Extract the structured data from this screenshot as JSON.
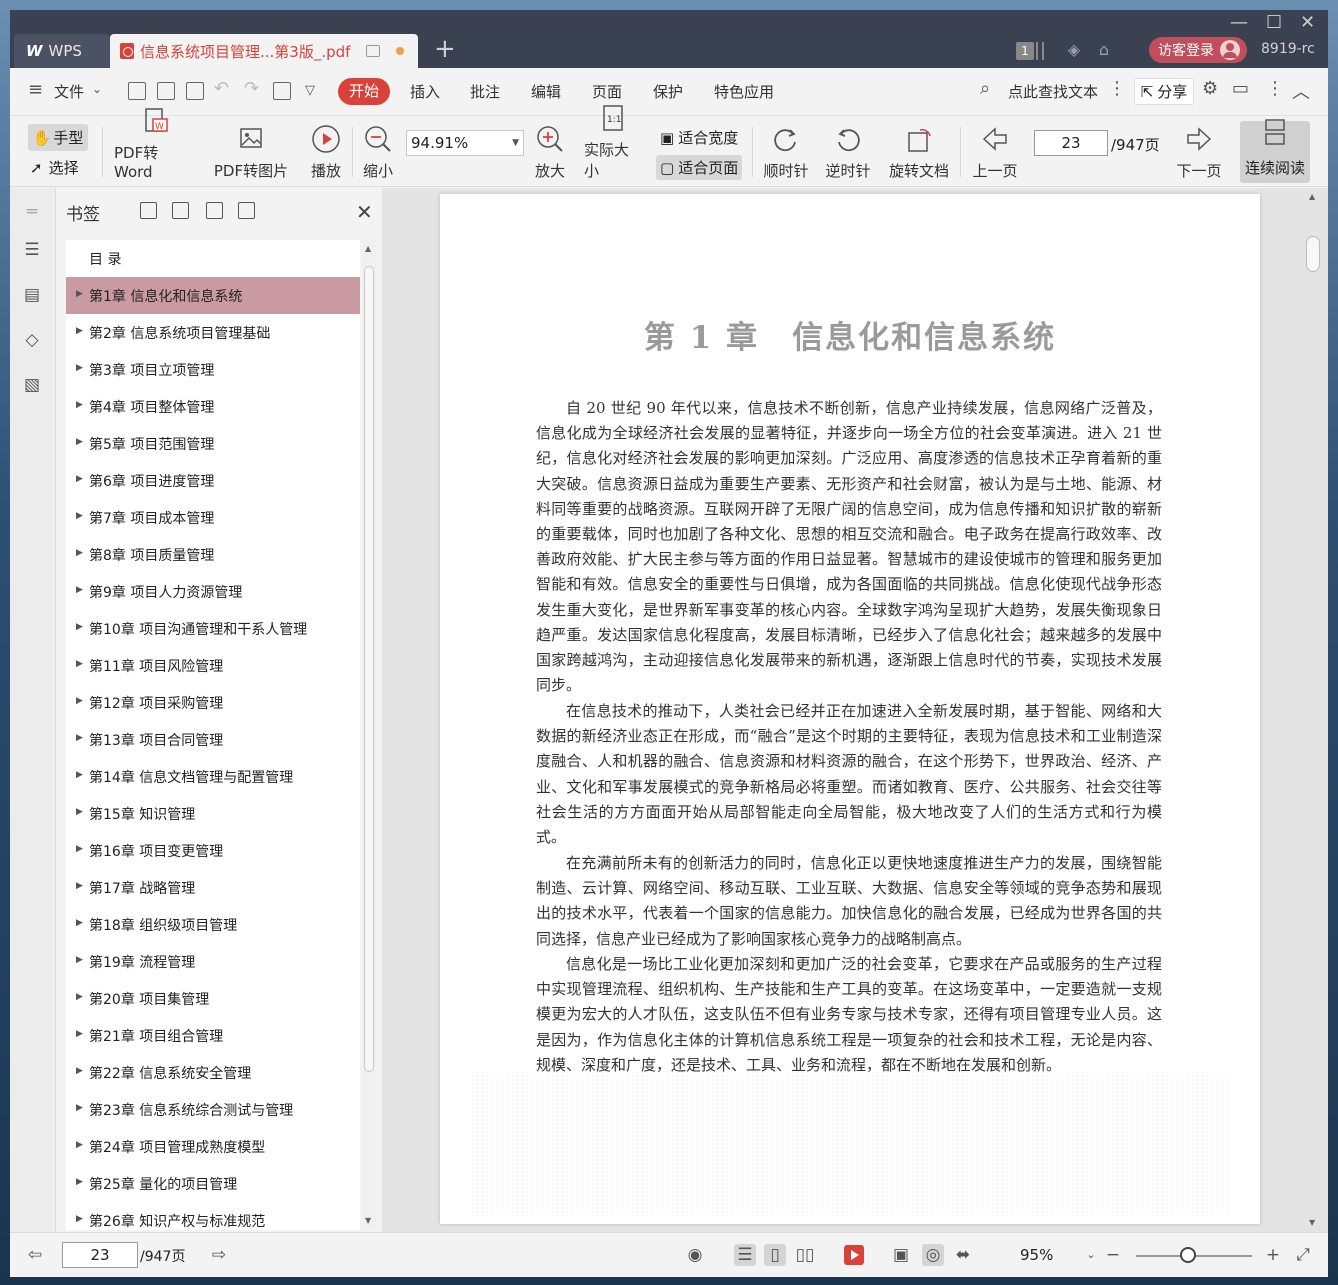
{
  "tabs": {
    "wps_label": "WPS",
    "doc_title": "信息系统项目管理...第3版_.pdf",
    "badge": "1",
    "login": "访客登录",
    "version": "8919-rc"
  },
  "menu": {
    "file": "文件",
    "items": [
      "开始",
      "插入",
      "批注",
      "编辑",
      "页面",
      "保护",
      "特色应用"
    ],
    "search": "点此查找文本",
    "share": "分享"
  },
  "toolbar": {
    "hand": "手型",
    "select": "选择",
    "pdf_to_word": "PDF转Word",
    "pdf_to_image": "PDF转图片",
    "play": "播放",
    "zoom_out": "缩小",
    "zoom_value": "94.91%",
    "zoom_in": "放大",
    "actual_size": "实际大小",
    "fit_width": "适合宽度",
    "fit_page": "适合页面",
    "clockwise": "顺时针",
    "counter_clockwise": "逆时针",
    "rotate_doc": "旋转文档",
    "prev_page": "上一页",
    "page_value": "23",
    "page_total": "/947页",
    "next_page": "下一页",
    "continuous": "连续阅读"
  },
  "bookmarks": {
    "title": "书签",
    "toc": "目 录",
    "items": [
      "第1章 信息化和信息系统",
      "第2章 信息系统项目管理基础",
      "第3章 项目立项管理",
      "第4章 项目整体管理",
      "第5章 项目范围管理",
      "第6章 项目进度管理",
      "第7章 项目成本管理",
      "第8章 项目质量管理",
      "第9章 项目人力资源管理",
      "第10章 项目沟通管理和干系人管理",
      "第11章 项目风险管理",
      "第12章 项目采购管理",
      "第13章 项目合同管理",
      "第14章 信息文档管理与配置管理",
      "第15章 知识管理",
      "第16章 项目变更管理",
      "第17章 战略管理",
      "第18章 组织级项目管理",
      "第19章 流程管理",
      "第20章 项目集管理",
      "第21章 项目组合管理",
      "第22章 信息系统安全管理",
      "第23章 信息系统综合测试与管理",
      "第24章 项目管理成熟度模型",
      "第25章 量化的项目管理",
      "第26章 知识产权与标准规范"
    ]
  },
  "document": {
    "chapter_title": "第 1 章　信息化和信息系统",
    "paragraphs": [
      "自 20 世纪 90 年代以来，信息技术不断创新，信息产业持续发展，信息网络广泛普及，信息化成为全球经济社会发展的显著特征，并逐步向一场全方位的社会变革演进。进入 21 世纪，信息化对经济社会发展的影响更加深刻。广泛应用、高度渗透的信息技术正孕育着新的重大突破。信息资源日益成为重要生产要素、无形资产和社会财富，被认为是与土地、能源、材料同等重要的战略资源。互联网开辟了无限广阔的信息空间，成为信息传播和知识扩散的崭新的重要载体，同时也加剧了各种文化、思想的相互交流和融合。电子政务在提高行政效率、改善政府效能、扩大民主参与等方面的作用日益显著。智慧城市的建设使城市的管理和服务更加智能和有效。信息安全的重要性与日俱增，成为各国面临的共同挑战。信息化使现代战争形态发生重大变化，是世界新军事变革的核心内容。全球数字鸿沟呈现扩大趋势，发展失衡现象日趋严重。发达国家信息化程度高，发展目标清晰，已经步入了信息化社会；越来越多的发展中国家跨越鸿沟，主动迎接信息化发展带来的新机遇，逐渐跟上信息时代的节奏，实现技术发展同步。",
      "在信息技术的推动下，人类社会已经并正在加速进入全新发展时期，基于智能、网络和大数据的新经济业态正在形成，而“融合”是这个时期的主要特征，表现为信息技术和工业制造深度融合、人和机器的融合、信息资源和材料资源的融合，在这个形势下，世界政治、经济、产业、文化和军事发展模式的竞争新格局必将重塑。而诸如教育、医疗、公共服务、社会交往等社会生活的方方面面开始从局部智能走向全局智能，极大地改变了人们的生活方式和行为模式。",
      "在充满前所未有的创新活力的同时，信息化正以更快地速度推进生产力的发展，围绕智能制造、云计算、网络空间、移动互联、工业互联、大数据、信息安全等领域的竞争态势和展现出的技术水平，代表着一个国家的信息能力。加快信息化的融合发展，已经成为世界各国的共同选择，信息产业已经成为了影响国家核心竞争力的战略制高点。",
      "信息化是一场比工业化更加深刻和更加广泛的社会变革，它要求在产品或服务的生产过程中实现管理流程、组织机构、生产技能和生产工具的变革。在这场变革中，一定要造就一支规模更为宏大的人才队伍，这支队伍不但有业务专家与技术专家，还得有项目管理专业人员。这是因为，作为信息化主体的计算机信息系统工程是一项复杂的社会和技术工程，无论是内容、规模、深度和广度，还是技术、工具、业务和流程，都在不断地在发展和创新。"
    ]
  },
  "status": {
    "page_value": "23",
    "page_total": "/947页",
    "zoom": "95%"
  },
  "colors": {
    "accent": "#d9423a",
    "selected_bookmark": "#c99aa1",
    "titlebar": "#3a4150"
  }
}
